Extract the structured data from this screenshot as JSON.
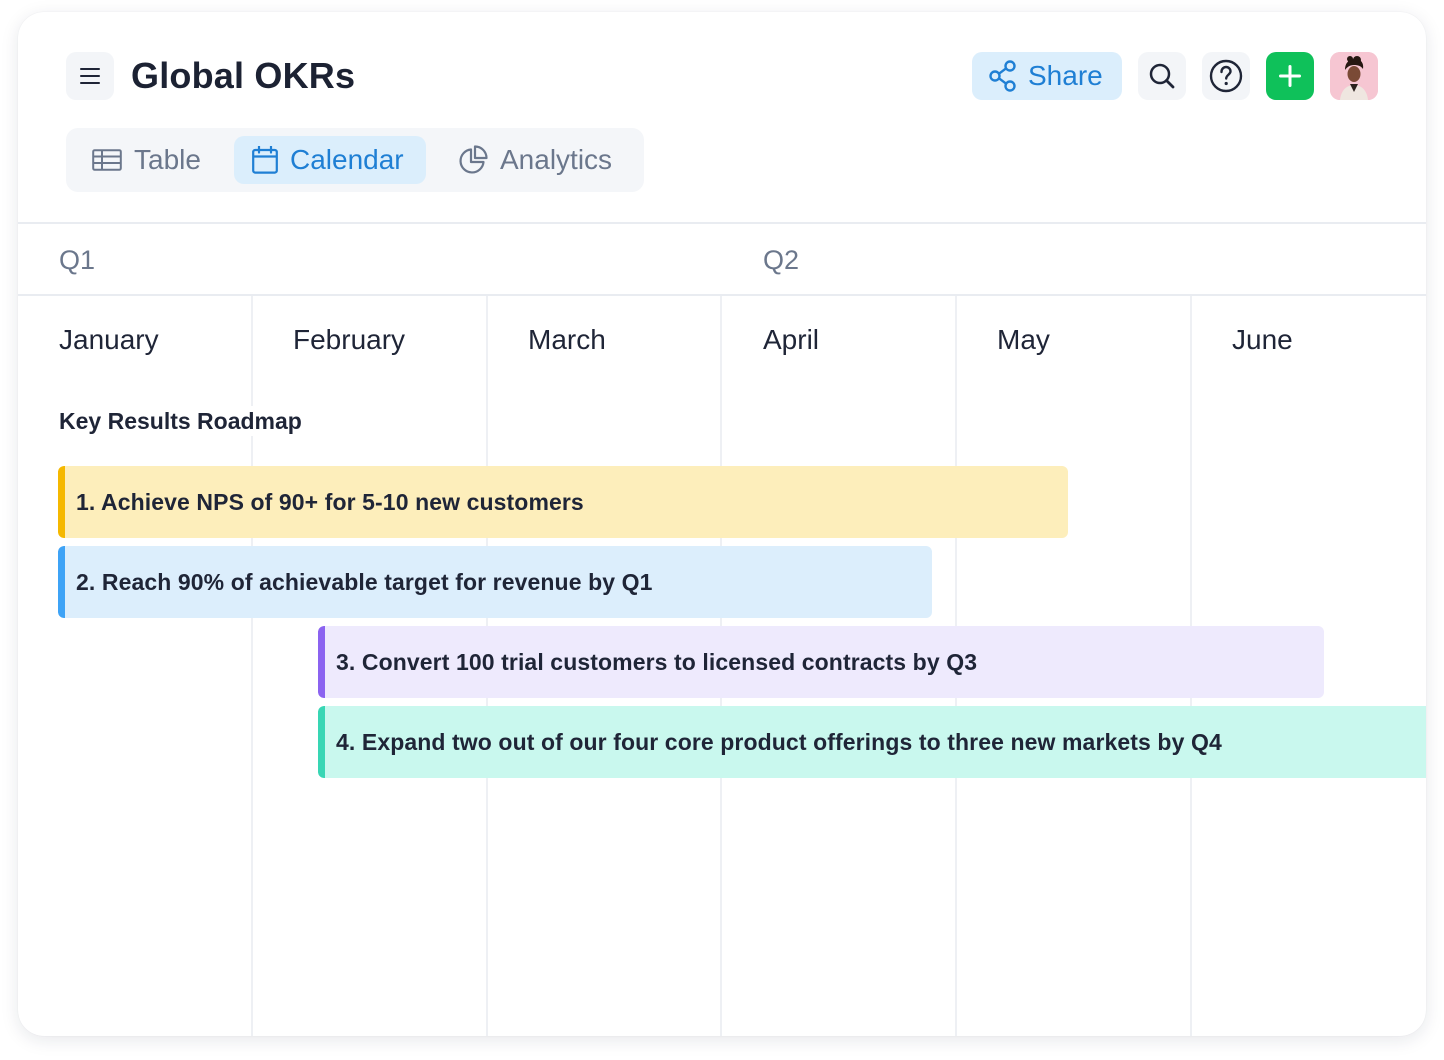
{
  "header": {
    "title": "Global OKRs",
    "share_label": "Share"
  },
  "view_tabs": [
    {
      "label": "Table",
      "icon": "table-icon",
      "active": false
    },
    {
      "label": "Calendar",
      "icon": "calendar-icon",
      "active": true
    },
    {
      "label": "Analytics",
      "icon": "pie-chart-icon",
      "active": false
    }
  ],
  "calendar": {
    "quarters": [
      "Q1",
      "Q2"
    ],
    "months": [
      "January",
      "February",
      "March",
      "April",
      "May",
      "June"
    ],
    "section_title": "Key Results Roadmap",
    "key_results": [
      {
        "label": "1. Achieve NPS of 90+ for 5-10 new customers",
        "color": "#fdeebb",
        "accent": "#f5b800"
      },
      {
        "label": "2. Reach 90% of achievable target for revenue by Q1",
        "color": "#dceefc",
        "accent": "#3ea3f6"
      },
      {
        "label": "3. Convert 100 trial customers to licensed contracts by Q3",
        "color": "#eeeafd",
        "accent": "#8b63f0"
      },
      {
        "label": "4. Expand two out of our four core product offerings to three new markets by Q4",
        "color": "#c9f8ee",
        "accent": "#38d6b4"
      }
    ]
  },
  "colors": {
    "accent_blue": "#1f7fd4",
    "add_green": "#0fc15a"
  }
}
